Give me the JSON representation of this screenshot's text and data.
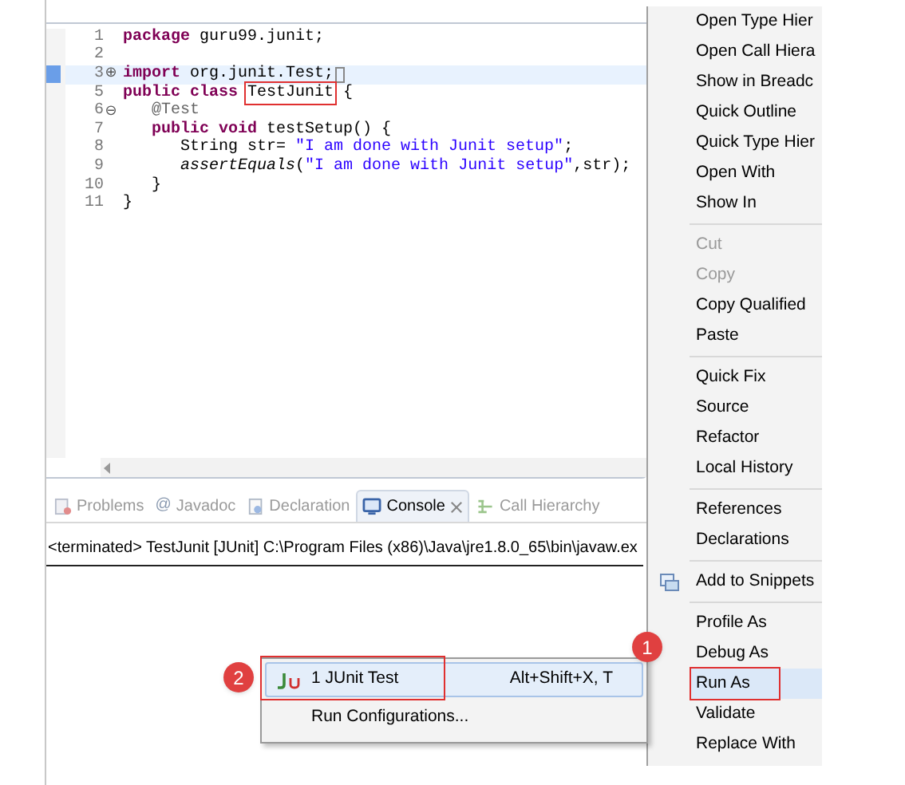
{
  "editor": {
    "lines": [
      {
        "number": "1",
        "current": false,
        "cursor": false,
        "segments": [
          {
            "kind": "keyword",
            "text": "package"
          },
          {
            "kind": "plain",
            "text": " guru99.junit;"
          }
        ]
      },
      {
        "number": "2",
        "current": false,
        "cursor": false
      },
      {
        "number": "3",
        "fold": "⊕",
        "current": true,
        "cursor": true,
        "segments": [
          {
            "kind": "keyword",
            "text": "import"
          },
          {
            "kind": "plain",
            "text": " org.junit.Test;"
          }
        ]
      },
      {
        "number": "5",
        "current": false,
        "cursor": false,
        "segments": [
          {
            "kind": "keyword",
            "text": "public class "
          },
          {
            "kind": "plain",
            "text": "TestJunit",
            "callout": true
          },
          {
            "kind": "plain",
            "text": " {"
          }
        ]
      },
      {
        "number": "6",
        "fold": "⊖",
        "current": false,
        "cursor": false,
        "segments": [
          {
            "kind": "annotation",
            "text": "   @Test"
          }
        ]
      },
      {
        "number": "7",
        "current": false,
        "cursor": false,
        "segments": [
          {
            "kind": "keyword",
            "text": "   public void"
          },
          {
            "kind": "plain",
            "text": " testSetup() {"
          }
        ]
      },
      {
        "number": "8",
        "current": false,
        "cursor": false,
        "segments": [
          {
            "kind": "plain",
            "text": "      String str= "
          },
          {
            "kind": "string",
            "text": "\"I am done with Junit setup\""
          },
          {
            "kind": "plain",
            "text": ";"
          }
        ]
      },
      {
        "number": "9",
        "current": false,
        "cursor": false,
        "segments": [
          {
            "kind": "italic",
            "text": "      assertEquals"
          },
          {
            "kind": "plain",
            "text": "("
          },
          {
            "kind": "string",
            "text": "\"I am done with Junit setup\""
          },
          {
            "kind": "plain",
            "text": ",str);"
          }
        ]
      },
      {
        "number": "10",
        "current": false,
        "cursor": false,
        "segments": [
          {
            "kind": "plain",
            "text": "   }"
          }
        ]
      },
      {
        "number": "11",
        "current": false,
        "cursor": false,
        "segments": [
          {
            "kind": "plain",
            "text": "}"
          }
        ]
      }
    ]
  },
  "bottom_tabs": [
    {
      "label": "Problems",
      "selected": false,
      "closable": false
    },
    {
      "label": "Javadoc",
      "glyph": "@",
      "selected": false,
      "closable": false
    },
    {
      "label": "Declaration",
      "selected": false,
      "closable": false
    },
    {
      "label": "Console",
      "selected": true,
      "closable": true
    },
    {
      "label": "Call Hierarchy",
      "selected": false,
      "closable": false
    }
  ],
  "console": {
    "text": "<terminated> TestJunit [JUnit] C:\\Program Files (x86)\\Java\\jre1.8.0_65\\bin\\javaw.ex"
  },
  "context_menu": {
    "items": [
      {
        "kind": "item",
        "label": "Open Type Hier",
        "disabled": false,
        "selected": false
      },
      {
        "kind": "item",
        "label": "Open Call Hiera",
        "disabled": false,
        "selected": false
      },
      {
        "kind": "item",
        "label": "Show in Breadc",
        "disabled": false,
        "selected": false
      },
      {
        "kind": "item",
        "label": "Quick Outline",
        "disabled": false,
        "selected": false
      },
      {
        "kind": "item",
        "label": "Quick Type Hier",
        "disabled": false,
        "selected": false
      },
      {
        "kind": "item",
        "label": "Open With",
        "disabled": false,
        "selected": false
      },
      {
        "kind": "item",
        "label": "Show In",
        "disabled": false,
        "selected": false
      },
      {
        "kind": "separator"
      },
      {
        "kind": "item",
        "label": "Cut",
        "disabled": true,
        "selected": false
      },
      {
        "kind": "item",
        "label": "Copy",
        "disabled": true,
        "selected": false
      },
      {
        "kind": "item",
        "label": "Copy Qualified",
        "disabled": false,
        "selected": false
      },
      {
        "kind": "item",
        "label": "Paste",
        "disabled": false,
        "selected": false
      },
      {
        "kind": "separator"
      },
      {
        "kind": "item",
        "label": "Quick Fix",
        "disabled": false,
        "selected": false
      },
      {
        "kind": "item",
        "label": "Source",
        "disabled": false,
        "selected": false
      },
      {
        "kind": "item",
        "label": "Refactor",
        "disabled": false,
        "selected": false
      },
      {
        "kind": "item",
        "label": "Local History",
        "disabled": false,
        "selected": false
      },
      {
        "kind": "separator"
      },
      {
        "kind": "item",
        "label": "References",
        "disabled": false,
        "selected": false
      },
      {
        "kind": "item",
        "label": "Declarations",
        "disabled": false,
        "selected": false
      },
      {
        "kind": "separator"
      },
      {
        "kind": "item",
        "label": "Add to Snippets",
        "disabled": false,
        "selected": false
      },
      {
        "kind": "separator"
      },
      {
        "kind": "item",
        "label": "Profile As",
        "disabled": false,
        "selected": false
      },
      {
        "kind": "item",
        "label": "Debug As",
        "disabled": false,
        "selected": false
      },
      {
        "kind": "item",
        "label": "Run As",
        "disabled": false,
        "selected": true,
        "callout": true
      },
      {
        "kind": "item",
        "label": "Validate",
        "disabled": false,
        "selected": false
      },
      {
        "kind": "item",
        "label": "Replace With",
        "disabled": false,
        "selected": false
      }
    ]
  },
  "submenu": {
    "items": [
      {
        "label": "1 JUnit Test",
        "shortcut": "Alt+Shift+X, T",
        "selected": true,
        "callout": true
      },
      {
        "label": "Run Configurations...",
        "selected": false,
        "callout": false
      }
    ]
  },
  "badges": [
    {
      "text": "1"
    },
    {
      "text": "2"
    }
  ]
}
